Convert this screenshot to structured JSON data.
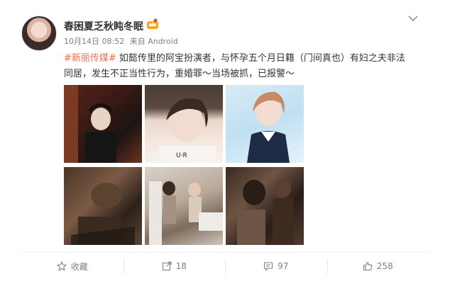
{
  "post": {
    "author": "春困夏乏秋盹冬眠",
    "timestamp": "10月14日 08:52",
    "source_prefix": "来自",
    "source": "Android",
    "hashtag": "#新丽传媒#",
    "body": " 如懿传里的阿宝扮演者，与怀孕五个月日籍（门间真也）有妇之夫非法同居，发生不正当性行为，重婚罪～当场被抓，已报警～",
    "images": [
      {
        "name": "photo-1"
      },
      {
        "name": "photo-2"
      },
      {
        "name": "photo-3"
      },
      {
        "name": "photo-4"
      },
      {
        "name": "photo-5"
      },
      {
        "name": "photo-6"
      }
    ]
  },
  "actions": {
    "favorite_label": "收藏",
    "repost_count": "18",
    "comment_count": "97",
    "like_count": "258"
  },
  "icons": {
    "more": "chevron-down-icon",
    "badge": "crown-icon",
    "favorite": "star-icon",
    "repost": "repost-icon",
    "comment": "comment-icon",
    "like": "thumbs-up-icon"
  },
  "colors": {
    "hashtag": "#eb7350",
    "meta": "#808080",
    "text": "#333333"
  }
}
